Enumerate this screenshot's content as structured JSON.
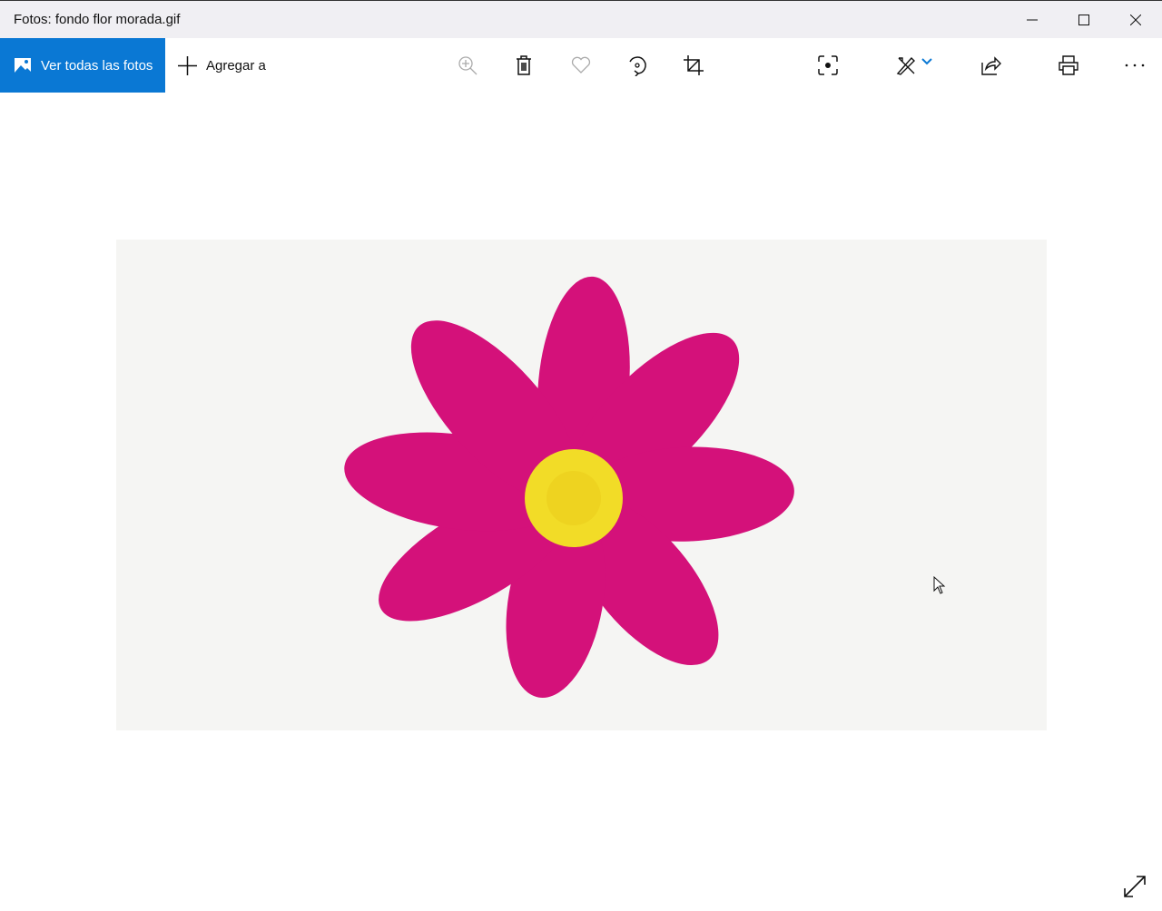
{
  "window": {
    "title": "Fotos: fondo flor morada.gif"
  },
  "toolbar": {
    "view_all_label": "Ver todas las fotos",
    "add_to_label": "Agregar a"
  },
  "colors": {
    "accent": "#0a78d4",
    "petal": "#d4117a",
    "center": "#f2dc27",
    "photo_bg": "#f5f5f3"
  }
}
